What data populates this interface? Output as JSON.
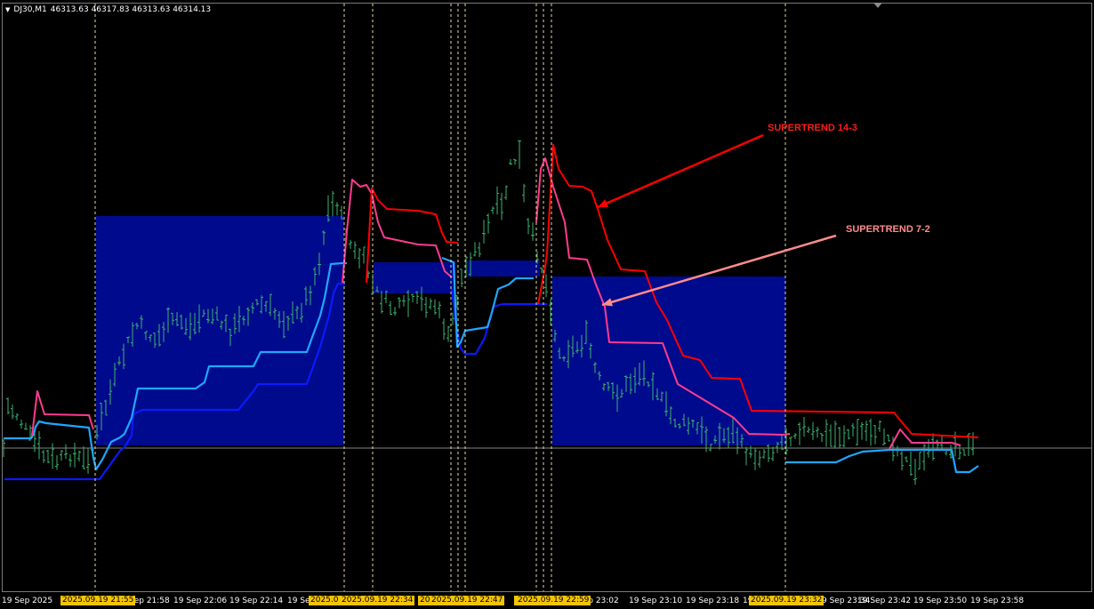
{
  "header": {
    "symbol": "DJ30,M1",
    "quotes": "46313.63 46317.83 46313.63 46314.13"
  },
  "annotations": {
    "supertrend_14_3": "SUPERTREND 14-3",
    "supertrend_7_2": "SUPERTREND 7-2"
  },
  "time_axis": {
    "labels": [
      "19 Sep 2025",
      "Sep 21:58",
      "19 Sep 22:06",
      "19 Sep 22:14",
      "19 Se",
      "Sep 23:02",
      "19 Sep 23:10",
      "19 Sep 23:18",
      "19 S",
      "9 Sep 23:34",
      "19 Sep 23:42",
      "19 Sep 23:50",
      "19 Sep 23:58"
    ],
    "vline_labels": [
      "2025.09.19 21:55",
      "2025.0",
      "2025.09.19 22:34",
      "20",
      "2025.09.19 22:47",
      "20",
      "2025.09.19 22:59",
      "2025.09.19 23:32"
    ]
  },
  "colors": {
    "background": "#000000",
    "bull_candle": "#3cb371",
    "supertrend_14_3": "#ff0000",
    "supertrend_7_2": "#ff3b8f",
    "support_light": "#1ea7ff",
    "support_dark": "#0a1aff",
    "zone_fill": "#000a8c",
    "vline": "#e8d9a0",
    "price_line": "#b0b0b0"
  }
}
